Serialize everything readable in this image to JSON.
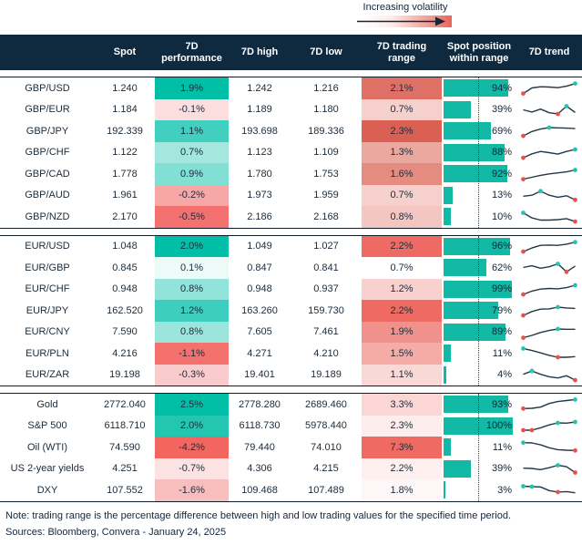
{
  "legend": {
    "label": "Increasing volatility"
  },
  "colors": {
    "header_bg": "#0f2a3f",
    "header_text": "#ffffff",
    "bar_teal": "#12b9a5",
    "spark_line": "#243747",
    "spark_min_dot": "#e4544c",
    "spark_max_dot": "#29c1af",
    "rule": "#101c28",
    "gradient_end_red": "#e8645a"
  },
  "footer": {
    "note": "Note: trading range is the percentage difference between high and low trading values for the specified time period.",
    "sources": "Sources: Bloomberg, Convera - January 24, 2025"
  },
  "chart_data": {
    "type": "table",
    "columns": [
      "",
      "Spot",
      "7D performance",
      "7D high",
      "7D low",
      "7D trading range",
      "Spot position within range",
      "7D trend"
    ],
    "legend_annotation": "Increasing volatility",
    "groups": [
      {
        "rows": [
          {
            "label": "GBP/USD",
            "spot": "1.240",
            "performance": "1.9%",
            "performance_color": "#00bfa6",
            "high": "1.242",
            "low": "1.216",
            "trading_range": "2.1%",
            "trading_range_color": "#df7066",
            "spot_position_pct": 94,
            "spot_position_label": "94%",
            "trend": {
              "points": [
                0.12,
                0.5,
                0.58,
                0.56,
                0.52,
                0.62,
                0.8
              ],
              "red_dots": [
                0
              ],
              "teal_dots": [
                6
              ]
            }
          },
          {
            "label": "GBP/EUR",
            "spot": "1.184",
            "performance": "-0.1%",
            "performance_color": "#fcdede",
            "high": "1.189",
            "low": "1.180",
            "trading_range": "0.7%",
            "trading_range_color": "#f6d0cd",
            "spot_position_pct": 39,
            "spot_position_label": "39%",
            "trend": {
              "points": [
                0.5,
                0.35,
                0.55,
                0.3,
                0.22,
                0.75,
                0.32
              ],
              "red_dots": [
                4
              ],
              "teal_dots": [
                5
              ]
            }
          },
          {
            "label": "GBP/JPY",
            "spot": "192.339",
            "performance": "1.1%",
            "performance_color": "#41cfc0",
            "high": "193.698",
            "low": "189.336",
            "trading_range": "2.3%",
            "trading_range_color": "#db6054",
            "spot_position_pct": 69,
            "spot_position_label": "69%",
            "trend": {
              "points": [
                0.15,
                0.45,
                0.62,
                0.72,
                0.7,
                0.68,
                0.65
              ],
              "red_dots": [
                0
              ],
              "teal_dots": [
                3
              ]
            }
          },
          {
            "label": "GBP/CHF",
            "spot": "1.122",
            "performance": "0.7%",
            "performance_color": "#a3e7df",
            "high": "1.123",
            "low": "1.109",
            "trading_range": "1.3%",
            "trading_range_color": "#eba89f",
            "spot_position_pct": 88,
            "spot_position_label": "88%",
            "trend": {
              "points": [
                0.15,
                0.42,
                0.58,
                0.5,
                0.4,
                0.58,
                0.72
              ],
              "red_dots": [
                0
              ],
              "teal_dots": [
                6
              ]
            }
          },
          {
            "label": "GBP/CAD",
            "spot": "1.778",
            "performance": "0.9%",
            "performance_color": "#82dfd3",
            "high": "1.780",
            "low": "1.753",
            "trading_range": "1.6%",
            "trading_range_color": "#e58b7f",
            "spot_position_pct": 92,
            "spot_position_label": "92%",
            "trend": {
              "points": [
                0.12,
                0.25,
                0.38,
                0.48,
                0.55,
                0.62,
                0.75
              ],
              "red_dots": [
                0
              ],
              "teal_dots": [
                6
              ]
            }
          },
          {
            "label": "GBP/AUD",
            "spot": "1.961",
            "performance": "-0.2%",
            "performance_color": "#f8a7a7",
            "high": "1.973",
            "low": "1.959",
            "trading_range": "0.7%",
            "trading_range_color": "#f6d0cd",
            "spot_position_pct": 13,
            "spot_position_label": "13%",
            "trend": {
              "points": [
                0.45,
                0.52,
                0.8,
                0.52,
                0.38,
                0.48,
                0.2
              ],
              "red_dots": [
                6
              ],
              "teal_dots": [
                2
              ]
            }
          },
          {
            "label": "GBP/NZD",
            "spot": "2.170",
            "performance": "-0.5%",
            "performance_color": "#f3716e",
            "high": "2.186",
            "low": "2.168",
            "trading_range": "0.8%",
            "trading_range_color": "#f4c6c1",
            "spot_position_pct": 10,
            "spot_position_label": "10%",
            "trend": {
              "points": [
                0.75,
                0.4,
                0.25,
                0.25,
                0.28,
                0.35,
                0.15
              ],
              "red_dots": [
                6
              ],
              "teal_dots": [
                0
              ]
            }
          }
        ]
      },
      {
        "rows": [
          {
            "label": "EUR/USD",
            "spot": "1.048",
            "performance": "2.0%",
            "performance_color": "#00bfa6",
            "high": "1.049",
            "low": "1.027",
            "trading_range": "2.2%",
            "trading_range_color": "#ee6a63",
            "spot_position_pct": 96,
            "spot_position_label": "96%",
            "trend": {
              "points": [
                0.15,
                0.4,
                0.58,
                0.6,
                0.58,
                0.66,
                0.8
              ],
              "red_dots": [
                0
              ],
              "teal_dots": [
                6
              ]
            }
          },
          {
            "label": "EUR/GBP",
            "spot": "0.845",
            "performance": "0.1%",
            "performance_color": "#ecfaf8",
            "high": "0.847",
            "low": "0.841",
            "trading_range": "0.7%",
            "trading_range_color": "#ffffff",
            "spot_position_pct": 62,
            "spot_position_label": "62%",
            "trend": {
              "points": [
                0.5,
                0.62,
                0.45,
                0.55,
                0.75,
                0.2,
                0.6
              ],
              "red_dots": [
                5
              ],
              "teal_dots": [
                4
              ]
            }
          },
          {
            "label": "EUR/CHF",
            "spot": "0.948",
            "performance": "0.8%",
            "performance_color": "#92e3d9",
            "high": "0.948",
            "low": "0.937",
            "trading_range": "1.2%",
            "trading_range_color": "#f8d0ce",
            "spot_position_pct": 99,
            "spot_position_label": "99%",
            "trend": {
              "points": [
                0.15,
                0.38,
                0.52,
                0.56,
                0.54,
                0.62,
                0.78
              ],
              "red_dots": [
                0
              ],
              "teal_dots": [
                6
              ]
            }
          },
          {
            "label": "EUR/JPY",
            "spot": "162.520",
            "performance": "1.2%",
            "performance_color": "#3ecec0",
            "high": "163.260",
            "low": "159.730",
            "trading_range": "2.2%",
            "trading_range_color": "#ee6a63",
            "spot_position_pct": 79,
            "spot_position_label": "79%",
            "trend": {
              "points": [
                0.15,
                0.42,
                0.58,
                0.6,
                0.72,
                0.66,
                0.63
              ],
              "red_dots": [
                0
              ],
              "teal_dots": [
                4
              ]
            }
          },
          {
            "label": "EUR/CNY",
            "spot": "7.590",
            "performance": "0.8%",
            "performance_color": "#9ce5dc",
            "high": "7.605",
            "low": "7.461",
            "trading_range": "1.9%",
            "trading_range_color": "#f0928b",
            "spot_position_pct": 89,
            "spot_position_label": "89%",
            "trend": {
              "points": [
                0.12,
                0.28,
                0.48,
                0.62,
                0.72,
                0.7,
                0.7
              ],
              "red_dots": [
                0
              ],
              "teal_dots": [
                4
              ]
            }
          },
          {
            "label": "EUR/PLN",
            "spot": "4.216",
            "performance": "-1.1%",
            "performance_color": "#f4716e",
            "high": "4.271",
            "low": "4.210",
            "trading_range": "1.5%",
            "trading_range_color": "#f5aca7",
            "spot_position_pct": 11,
            "spot_position_label": "11%",
            "trend": {
              "points": [
                0.82,
                0.68,
                0.52,
                0.35,
                0.22,
                0.22,
                0.26
              ],
              "red_dots": [
                4
              ],
              "teal_dots": [
                0
              ]
            }
          },
          {
            "label": "EUR/ZAR",
            "spot": "19.198",
            "performance": "-0.3%",
            "performance_color": "#facbcc",
            "high": "19.401",
            "low": "19.189",
            "trading_range": "1.1%",
            "trading_range_color": "#fad8d6",
            "spot_position_pct": 4,
            "spot_position_label": "4%",
            "trend": {
              "points": [
                0.55,
                0.78,
                0.55,
                0.38,
                0.3,
                0.45,
                0.15
              ],
              "red_dots": [
                6
              ],
              "teal_dots": [
                1
              ]
            }
          }
        ]
      },
      {
        "rows": [
          {
            "label": "Gold",
            "spot": "2772.040",
            "performance": "2.5%",
            "performance_color": "#00bfa6",
            "high": "2778.280",
            "low": "2689.460",
            "trading_range": "3.3%",
            "trading_range_color": "#fbd6d4",
            "spot_position_pct": 93,
            "spot_position_label": "93%",
            "trend": {
              "points": [
                0.2,
                0.22,
                0.3,
                0.55,
                0.68,
                0.75,
                0.82
              ],
              "red_dots": [
                0
              ],
              "teal_dots": [
                6
              ]
            }
          },
          {
            "label": "S&P 500",
            "spot": "6118.710",
            "performance": "2.0%",
            "performance_color": "#23c6b1",
            "high": "6118.730",
            "low": "5978.440",
            "trading_range": "2.3%",
            "trading_range_color": "#fdedec",
            "spot_position_pct": 100,
            "spot_position_label": "100%",
            "trend": {
              "points": [
                0.22,
                0.22,
                0.38,
                0.58,
                0.72,
                0.7,
                0.78
              ],
              "red_dots": [
                0,
                1
              ],
              "teal_dots": [
                4,
                6
              ]
            }
          },
          {
            "label": "Oil (WTI)",
            "spot": "74.590",
            "performance": "-4.2%",
            "performance_color": "#f3655f",
            "high": "79.440",
            "low": "74.010",
            "trading_range": "7.3%",
            "trading_range_color": "#ee6a63",
            "spot_position_pct": 11,
            "spot_position_label": "11%",
            "trend": {
              "points": [
                0.8,
                0.78,
                0.65,
                0.45,
                0.32,
                0.28,
                0.26
              ],
              "red_dots": [
                6
              ],
              "teal_dots": [
                0
              ]
            }
          },
          {
            "label": "US 2-year yields",
            "spot": "4.251",
            "performance": "-0.7%",
            "performance_color": "#fbe3e3",
            "high": "4.306",
            "low": "4.215",
            "trading_range": "2.2%",
            "trading_range_color": "#fdf0ef",
            "spot_position_pct": 39,
            "spot_position_label": "39%",
            "trend": {
              "points": [
                0.55,
                0.53,
                0.45,
                0.58,
                0.75,
                0.65,
                0.25
              ],
              "red_dots": [
                6
              ],
              "teal_dots": [
                4
              ]
            }
          },
          {
            "label": "DXY",
            "spot": "107.552",
            "performance": "-1.6%",
            "performance_color": "#f8bebe",
            "high": "109.468",
            "low": "107.489",
            "trading_range": "1.8%",
            "trading_range_color": "#fef7f7",
            "spot_position_pct": 3,
            "spot_position_label": "3%",
            "trend": {
              "points": [
                0.75,
                0.72,
                0.7,
                0.45,
                0.35,
                0.38,
                0.3
              ],
              "red_dots": [
                4
              ],
              "teal_dots": [
                0,
                1
              ]
            }
          }
        ]
      }
    ]
  }
}
